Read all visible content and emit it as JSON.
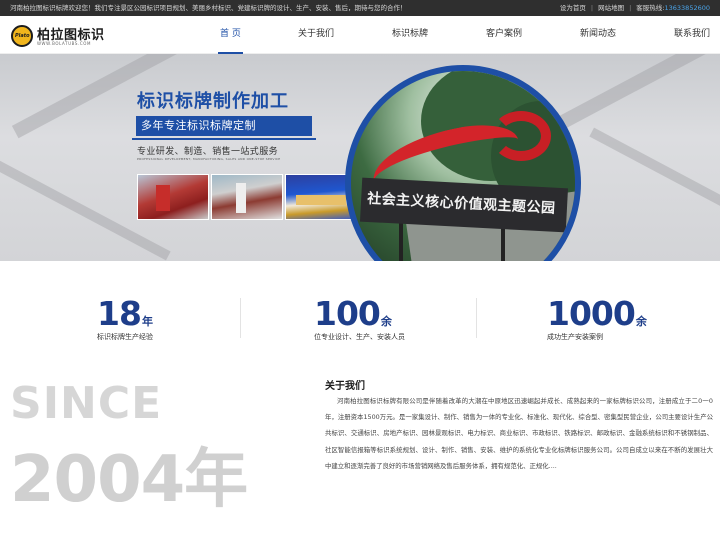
{
  "topbar": {
    "welcome": "河南柏拉图标识标牌欢迎您！我们专注景区公园标识项目规划、美丽乡村标识、党建标识牌的设计、生产、安装、售后，期待与您的合作！",
    "set_home": "设为首页",
    "sitemap": "网站地图",
    "hotline_label": "客服热线:",
    "hotline_number": "13633852600"
  },
  "logo": {
    "mark_text": "Plato",
    "name": "柏拉图标识",
    "sub": "WWW.BOLATUBS.COM"
  },
  "nav": {
    "items": [
      {
        "label": "首 页"
      },
      {
        "label": "关于我们"
      },
      {
        "label": "标识标牌"
      },
      {
        "label": "客户案例"
      },
      {
        "label": "新闻动态"
      },
      {
        "label": "联系我们"
      }
    ]
  },
  "banner": {
    "title": "标识标牌制作加工",
    "subtitle": "多年专注标识标牌定制",
    "desc": "专业研发、制造、销售一站式服务",
    "desc_en": "PROFESSIONAL DEVELOPMENT, MANUFACTURING, SALES AND ONE-STOP SERVICE",
    "sign_text": "社会主义核心价值观主题公园",
    "dots": [
      "01",
      "02"
    ]
  },
  "stats": [
    {
      "number": "18",
      "unit": "年",
      "label": "标识标牌生产经验"
    },
    {
      "number": "100",
      "unit": "余",
      "label": "位专业设计、生产、安装人员"
    },
    {
      "number": "1000",
      "unit": "余",
      "label": "成功生产安装案例"
    }
  ],
  "since": {
    "word": "SINCE",
    "year": "2004年"
  },
  "about": {
    "title": "关于我们",
    "text": "河南柏拉图标识标牌有限公司是伴随着改革的大潮在中原地区迅速崛起并成长、成熟起来的一家标牌标识公司，注册成立于二0一0年，注册资本1500万元。是一家集设计、制作、销售为一体的专业化、标准化、现代化、综合型、密集型民营企业，公司主要设计生产公共标识、交通标识、房地产标识、园林景观标识、电力标识、商业标识、市政标识、铁路标识、邮政标识、金融系统标识和不锈钢制品、社区智能信报箱等标识系统规划、设计、制作、销售、安装、维护的系统化专业化标牌标识服务公司。公司自成立以来在不断的发展壮大中建立和逐渐完善了良好的市场营销网络及售后服务体系，拥有规范化、正规化...."
  },
  "colors": {
    "brand_blue": "#1e4fa6",
    "stat_blue": "#1e3e8a",
    "topbar_bg": "#2f2f2f",
    "phone_blue": "#4aa3e8",
    "accent_red": "#d3242a"
  }
}
